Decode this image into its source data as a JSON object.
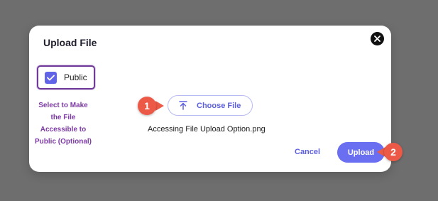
{
  "modal": {
    "title": "Upload File",
    "close_icon": "close-icon"
  },
  "public_option": {
    "label": "Public",
    "checked": true,
    "accent_color": "#6264e8",
    "highlight_border_color": "#6f3a9a"
  },
  "annotation_note": "Select to Make the File Accessible to Public (Optional)",
  "file_picker": {
    "button_label": "Choose File",
    "icon": "upload-arrow-icon",
    "selected_file": "Accessing File Upload Option.png"
  },
  "actions": {
    "cancel_label": "Cancel",
    "upload_label": "Upload",
    "primary_color": "#6a6ef0"
  },
  "callouts": [
    {
      "label": "1",
      "points_to": "Choose File"
    },
    {
      "label": "2",
      "points_to": "Upload"
    }
  ],
  "colors": {
    "overlay": "#6e6e6e",
    "callout": "#ec5a47",
    "note_text": "#7d3aa5"
  }
}
